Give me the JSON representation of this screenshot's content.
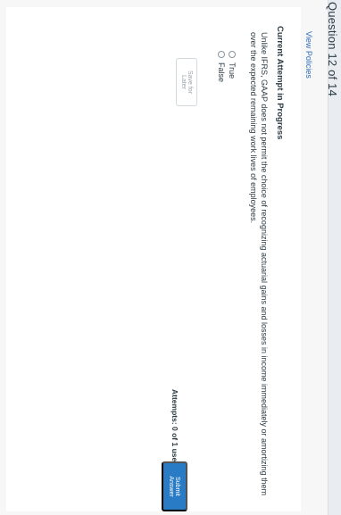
{
  "header": {
    "question_label": "Question 12 of 14"
  },
  "links": {
    "view_policies": "View Policies"
  },
  "attempt": {
    "status_heading": "Current Attempt in Progress",
    "attempts_text": "Attempts: 0 of 1 used"
  },
  "question": {
    "text": "Unlike IFRS, GAAP does not permit the choice of recognizing actuarial gains and losses in income immediately or amortizing them over the expected remaining work lives of employees.",
    "options": [
      {
        "label": "True",
        "selected": false
      },
      {
        "label": "False",
        "selected": false
      }
    ]
  },
  "buttons": {
    "save_for_later": "Save for Later",
    "submit_answer": "Submit Answer"
  },
  "colors": {
    "accent": "#2a7bc5",
    "link": "#2d6bb7"
  }
}
